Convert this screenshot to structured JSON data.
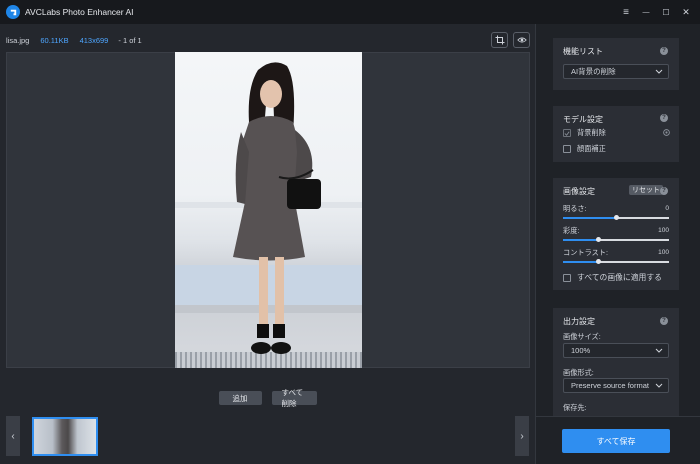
{
  "app": {
    "title": "AVCLabs Photo Enhancer AI"
  },
  "window_controls": {
    "menu": "≡",
    "minimize": "—",
    "maximize": "☐",
    "close": "✕"
  },
  "file_info": {
    "name": "lisa.jpg",
    "size": "60.11KB",
    "dimensions": "413x699",
    "page": "- 1 of 1"
  },
  "actions": {
    "add_label": "追加",
    "delete_all_label": "すべて削除"
  },
  "thumbnails": {
    "prev": "‹",
    "next": "›"
  },
  "sidebar": {
    "function_list": {
      "title": "機能リスト",
      "selected": "AI背景の削除"
    },
    "model_settings": {
      "title": "モデル設定",
      "options": [
        {
          "label": "背景削除",
          "checked": true
        },
        {
          "label": "顔面補正",
          "checked": false
        }
      ]
    },
    "image_settings": {
      "title": "画像設定",
      "reset_label": "リセット",
      "sliders": [
        {
          "label": "明るさ:",
          "value": "0",
          "fraction": 0.5
        },
        {
          "label": "彩度:",
          "value": "100",
          "fraction": 0.33
        },
        {
          "label": "コントラスト:",
          "value": "100",
          "fraction": 0.33
        }
      ],
      "apply_all_label": "すべての画像に適用する"
    },
    "output_settings": {
      "title": "出力設定",
      "image_size_label": "画像サイズ:",
      "image_size_value": "100%",
      "image_format_label": "画像形式:",
      "image_format_value": "Preserve source format",
      "save_to_label": "保存先:"
    },
    "save_all_label": "すべて保存"
  },
  "colors": {
    "accent": "#2f8ef0",
    "info_blue": "#4ea6ff",
    "panel": "#2b2e35"
  }
}
